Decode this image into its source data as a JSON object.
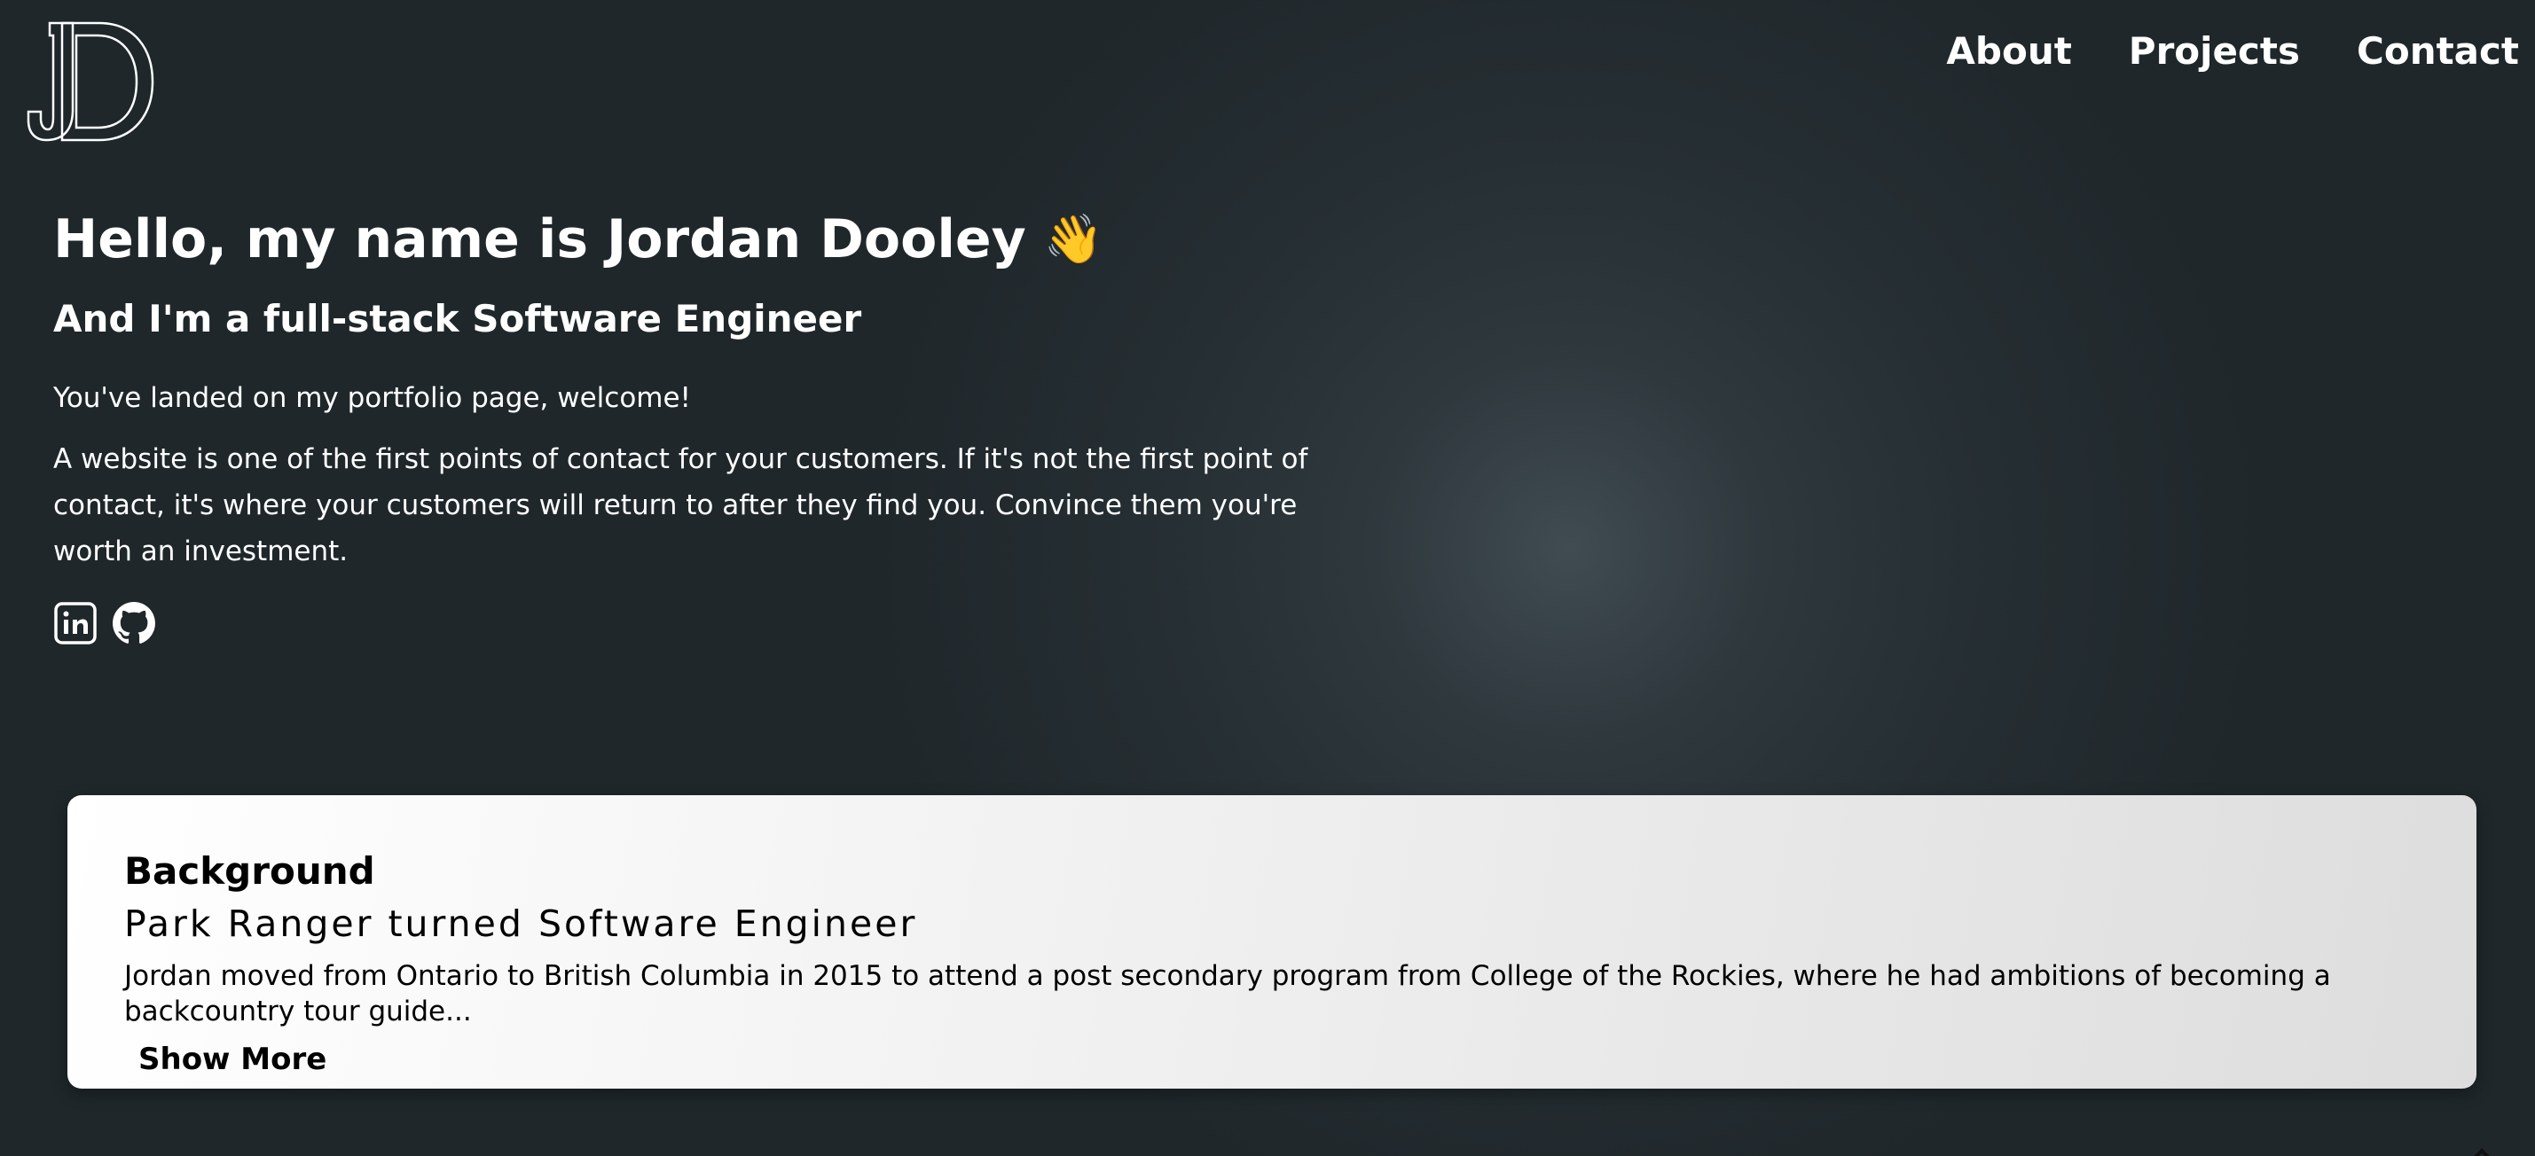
{
  "header": {
    "logo_text": "JD",
    "nav": [
      "About",
      "Projects",
      "Contact"
    ]
  },
  "hero": {
    "heading": "Hello, my name is Jordan Dooley",
    "wave_emoji": "👋",
    "subheading": "And I'm a full-stack Software Engineer",
    "welcome": "You've landed on my portfolio page, welcome!",
    "pitch": "A website is one of the first points of contact for your customers. If it's not the first point of contact, it's where your customers will return to after they find you. Convince them you're worth an investment.",
    "socials": [
      {
        "icon": "linkedin-icon"
      },
      {
        "icon": "github-icon"
      }
    ]
  },
  "background_card": {
    "title": "Background",
    "subtitle": "Park Ranger turned Software Engineer",
    "summary": "Jordan moved from Ontario to British Columbia in 2015 to attend a post secondary program from College of the Rockies, where he had ambitions of becoming a backcountry tour guide...",
    "show_more_label": "Show More"
  },
  "colors": {
    "page_background": "#1f272b",
    "glow_center": "#404b52",
    "text": "#ffffff",
    "card_background": "#f4f4f4",
    "card_text": "#000000"
  }
}
